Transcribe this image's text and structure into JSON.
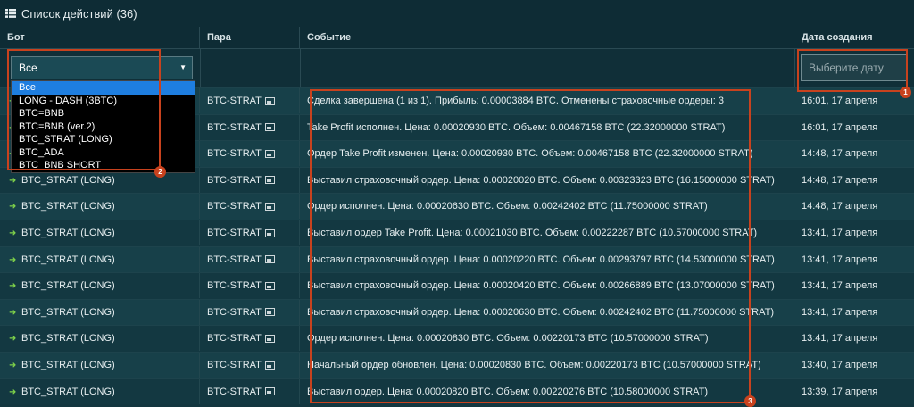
{
  "title": "Список действий (36)",
  "columns": {
    "bot": "Бот",
    "pair": "Пара",
    "event": "Событие",
    "date": "Дата создания"
  },
  "filters": {
    "bot_selected": "Все",
    "date_placeholder": "Выберите дату",
    "bot_options": [
      "Все",
      "LONG - DASH (3BTC)",
      "BTC=BNB",
      "BTC=BNB (ver.2)",
      "BTC_STRAT (LONG)",
      "BTC_ADA",
      "BTC_BNB SHORT"
    ]
  },
  "rows": [
    {
      "bot": "",
      "pair": "BTC-STRAT",
      "event": "Сделка завершена (1 из 1). Прибыль: 0.00003884 BTC. Отменены страховочные ордеры: 3",
      "date": "16:01, 17 апреля"
    },
    {
      "bot": "",
      "pair": "BTC-STRAT",
      "event": "Take Profit исполнен. Цена: 0.00020930 BTC. Объем: 0.00467158 BTC (22.32000000 STRAT)",
      "date": "16:01, 17 апреля"
    },
    {
      "bot": "",
      "pair": "BTC-STRAT",
      "event": "Ордер Take Profit изменен. Цена: 0.00020930 BTC. Объем: 0.00467158 BTC (22.32000000 STRAT)",
      "date": "14:48, 17 апреля"
    },
    {
      "bot": "BTC_STRAT (LONG)",
      "pair": "BTC-STRAT",
      "event": "Выставил страховочный ордер. Цена: 0.00020020 BTC. Объем: 0.00323323 BTC (16.15000000 STRAT)",
      "date": "14:48, 17 апреля"
    },
    {
      "bot": "BTC_STRAT (LONG)",
      "pair": "BTC-STRAT",
      "event": "Ордер исполнен. Цена: 0.00020630 BTC. Объем: 0.00242402 BTC (11.75000000 STRAT)",
      "date": "14:48, 17 апреля"
    },
    {
      "bot": "BTC_STRAT (LONG)",
      "pair": "BTC-STRAT",
      "event": "Выставил ордер Take Profit. Цена: 0.00021030 BTC. Объем: 0.00222287 BTC (10.57000000 STRAT)",
      "date": "13:41, 17 апреля"
    },
    {
      "bot": "BTC_STRAT (LONG)",
      "pair": "BTC-STRAT",
      "event": "Выставил страховочный ордер. Цена: 0.00020220 BTC. Объем: 0.00293797 BTC (14.53000000 STRAT)",
      "date": "13:41, 17 апреля"
    },
    {
      "bot": "BTC_STRAT (LONG)",
      "pair": "BTC-STRAT",
      "event": "Выставил страховочный ордер. Цена: 0.00020420 BTC. Объем: 0.00266889 BTC (13.07000000 STRAT)",
      "date": "13:41, 17 апреля"
    },
    {
      "bot": "BTC_STRAT (LONG)",
      "pair": "BTC-STRAT",
      "event": "Выставил страховочный ордер. Цена: 0.00020630 BTC. Объем: 0.00242402 BTC (11.75000000 STRAT)",
      "date": "13:41, 17 апреля"
    },
    {
      "bot": "BTC_STRAT (LONG)",
      "pair": "BTC-STRAT",
      "event": "Ордер исполнен. Цена: 0.00020830 BTC. Объем: 0.00220173 BTC (10.57000000 STRAT)",
      "date": "13:41, 17 апреля"
    },
    {
      "bot": "BTC_STRAT (LONG)",
      "pair": "BTC-STRAT",
      "event": "Начальный ордер обновлен. Цена: 0.00020830 BTC. Объем: 0.00220173 BTC (10.57000000 STRAT)",
      "date": "13:40, 17 апреля"
    },
    {
      "bot": "BTC_STRAT (LONG)",
      "pair": "BTC-STRAT",
      "event": "Выставил ордер. Цена: 0.00020820 BTC. Объем: 0.00220276 BTC (10.58000000 STRAT)",
      "date": "13:39, 17 апреля"
    }
  ],
  "callouts": [
    "1",
    "2",
    "3"
  ],
  "colors": {
    "callout": "#c8421e",
    "background": "#13363f",
    "selected_option": "#1e7ee0"
  },
  "icons": {
    "title": "list-icon",
    "bot_row": "arrow-right-icon",
    "pair": "image-icon"
  }
}
